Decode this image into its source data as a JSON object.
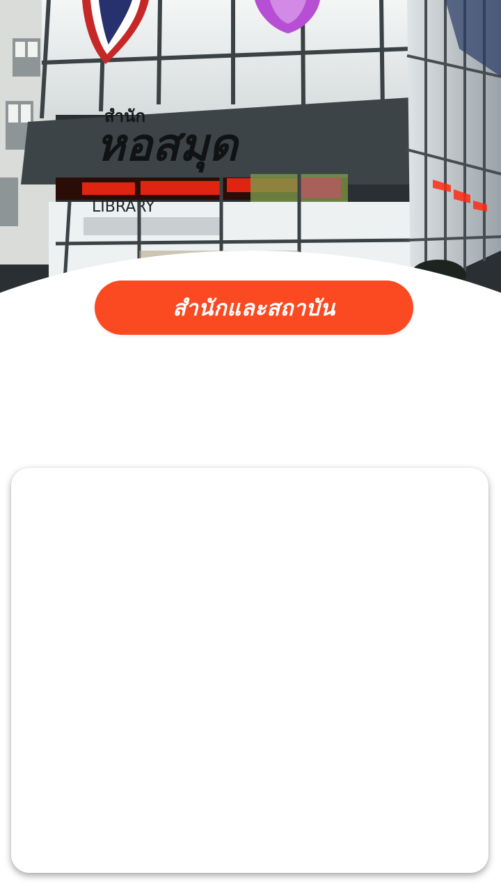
{
  "hero": {
    "image_name": "library-building-photo",
    "sign_thai": "สำนัก",
    "sign_main": "หอสมุด",
    "sign_english": "LIBRARY",
    "colors": {
      "night_sky": "#2a2f33",
      "glass": "#e9eef0",
      "led_text": "#ff2a14"
    }
  },
  "title": {
    "label": "สำนักและสถาบัน",
    "color": "#fb4a21"
  },
  "content_card": {
    "items": []
  }
}
